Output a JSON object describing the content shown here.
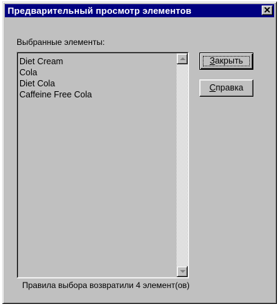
{
  "window": {
    "title": "Предварительный просмотр элементов",
    "close_glyph": "✕"
  },
  "selected_label": "Выбранные элементы:",
  "items": [
    "Diet Cream",
    "Cola",
    "Diet Cola",
    "Caffeine Free Cola"
  ],
  "buttons": {
    "close": {
      "mnemonic": "З",
      "rest": "акрыть"
    },
    "help": {
      "mnemonic": "С",
      "rest": "правка"
    }
  },
  "status_text": "Правила выбора возвратили 4 элемент(ов)",
  "icons": {
    "close": "close-icon",
    "scroll_up": "chevron-up-icon",
    "scroll_down": "chevron-down-icon"
  },
  "colors": {
    "titlebar": "#000080",
    "face": "#c0c0c0"
  }
}
